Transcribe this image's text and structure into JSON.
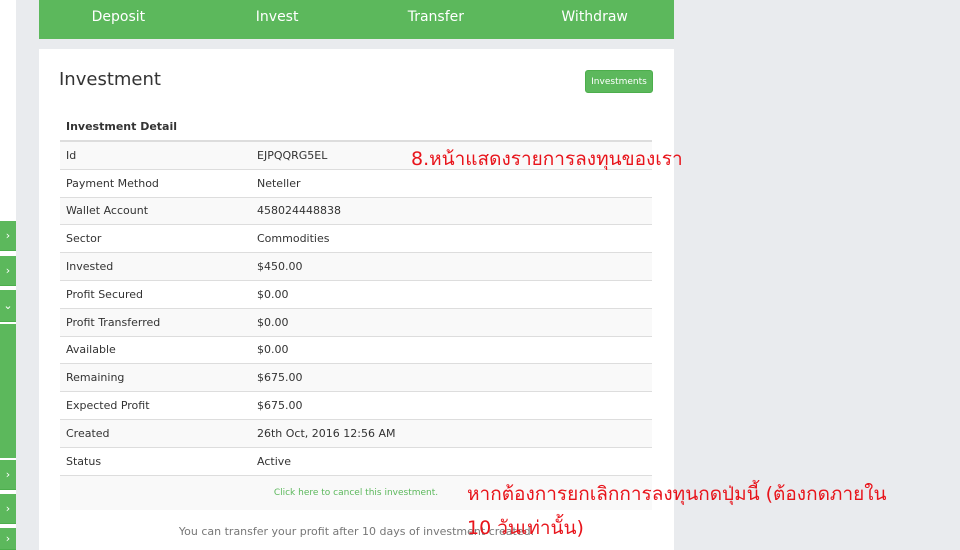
{
  "nav": {
    "items": [
      {
        "label": "Deposit"
      },
      {
        "label": "Invest"
      },
      {
        "label": "Transfer"
      },
      {
        "label": "Withdraw"
      }
    ]
  },
  "sidebar": {
    "tabs": [
      "›",
      "›",
      "⌄",
      "›",
      "›",
      "›"
    ]
  },
  "investment": {
    "title": "Investment",
    "investments_button": "Investments",
    "detail_header": "Investment Detail",
    "rows": [
      {
        "label": "Id",
        "value": "EJPQQRG5EL"
      },
      {
        "label": "Payment Method",
        "value": "Neteller"
      },
      {
        "label": "Wallet Account",
        "value": "458024448838"
      },
      {
        "label": "Sector",
        "value": "Commodities"
      },
      {
        "label": "Invested",
        "value": "$450.00"
      },
      {
        "label": "Profit Secured",
        "value": "$0.00"
      },
      {
        "label": "Profit Transferred",
        "value": "$0.00"
      },
      {
        "label": "Available",
        "value": "$0.00"
      },
      {
        "label": "Remaining",
        "value": "$675.00"
      },
      {
        "label": "Expected Profit",
        "value": "$675.00"
      },
      {
        "label": "Created",
        "value": "26th Oct, 2016 12:56 AM"
      },
      {
        "label": "Status",
        "value": "Active"
      }
    ],
    "cancel_link": "Click here to cancel this investment.",
    "transfer_note": "You can transfer your profit after 10 days of investment created."
  },
  "annotations": {
    "top": "8.หน้าแสดงรายการลงทุนของเรา",
    "bottom_line1": "หากต้องการยกเลิกการลงทุนกดปุ่มนี้ (ต้องกดภายใน",
    "bottom_line2": "10 วันเท่านั้น)"
  },
  "colors": {
    "accent": "#5cb85c",
    "annotation": "#e8141b"
  }
}
